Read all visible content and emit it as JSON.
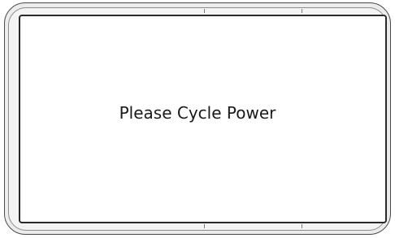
{
  "screen": {
    "message": "Please Cycle Power"
  },
  "colors": {
    "bezel": "#ececec",
    "bezel_border": "#4a4a4a",
    "screen_background": "#ffffff",
    "screen_border": "#2a2a2a",
    "text": "#1a1a1a"
  }
}
